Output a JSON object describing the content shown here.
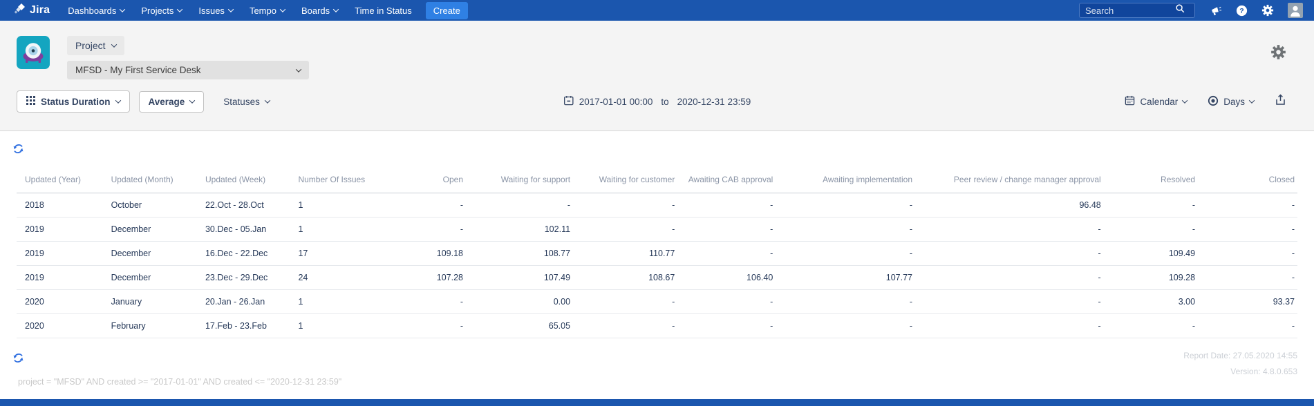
{
  "navbar": {
    "brand": "Jira",
    "items": [
      "Dashboards",
      "Projects",
      "Issues",
      "Tempo",
      "Boards",
      "Time in Status"
    ],
    "create_label": "Create",
    "search_placeholder": "Search"
  },
  "project_bar": {
    "scope_label": "Project",
    "project_name": "MFSD - My First Service Desk"
  },
  "toolbar": {
    "report_type": "Status Duration",
    "metric": "Average",
    "statuses_label": "Statuses",
    "date_from": "2017-01-01 00:00",
    "date_join": "to",
    "date_to": "2020-12-31 23:59",
    "calendar_label": "Calendar",
    "unit_label": "Days"
  },
  "table": {
    "columns": [
      "Updated (Year)",
      "Updated (Month)",
      "Updated (Week)",
      "Number Of Issues",
      "Open",
      "Waiting for support",
      "Waiting for customer",
      "Awaiting CAB approval",
      "Awaiting implementation",
      "Peer review / change manager approval",
      "Resolved",
      "Closed"
    ],
    "rows": [
      [
        "2018",
        "October",
        "22.Oct - 28.Oct",
        "1",
        "-",
        "-",
        "-",
        "-",
        "-",
        "96.48",
        "-",
        "-"
      ],
      [
        "2019",
        "December",
        "30.Dec - 05.Jan",
        "1",
        "-",
        "102.11",
        "-",
        "-",
        "-",
        "-",
        "-",
        "-"
      ],
      [
        "2019",
        "December",
        "16.Dec - 22.Dec",
        "17",
        "109.18",
        "108.77",
        "110.77",
        "-",
        "-",
        "-",
        "109.49",
        "-"
      ],
      [
        "2019",
        "December",
        "23.Dec - 29.Dec",
        "24",
        "107.28",
        "107.49",
        "108.67",
        "106.40",
        "107.77",
        "-",
        "109.28",
        "-"
      ],
      [
        "2020",
        "January",
        "20.Jan - 26.Jan",
        "1",
        "-",
        "0.00",
        "-",
        "-",
        "-",
        "-",
        "3.00",
        "93.37"
      ],
      [
        "2020",
        "February",
        "17.Feb - 23.Feb",
        "1",
        "-",
        "65.05",
        "-",
        "-",
        "-",
        "-",
        "-",
        "-"
      ]
    ]
  },
  "footer": {
    "jql": "project = \"MFSD\" AND created >= \"2017-01-01\" AND created <= \"2020-12-31 23:59\"",
    "report_date": "Report Date: 27.05.2020 14:55",
    "version": "Version: 4.8.0.653"
  },
  "colors": {
    "navbar": "#1b56ae",
    "create": "#2f80e4",
    "search": "#10459c",
    "band": "#f4f4f4",
    "teal": "#14a5c0",
    "purple": "#7e3f9d",
    "text": "#344563",
    "muted": "#8a94a6",
    "faint": "#ccd0d6",
    "refresh": "#2f6fe0"
  }
}
